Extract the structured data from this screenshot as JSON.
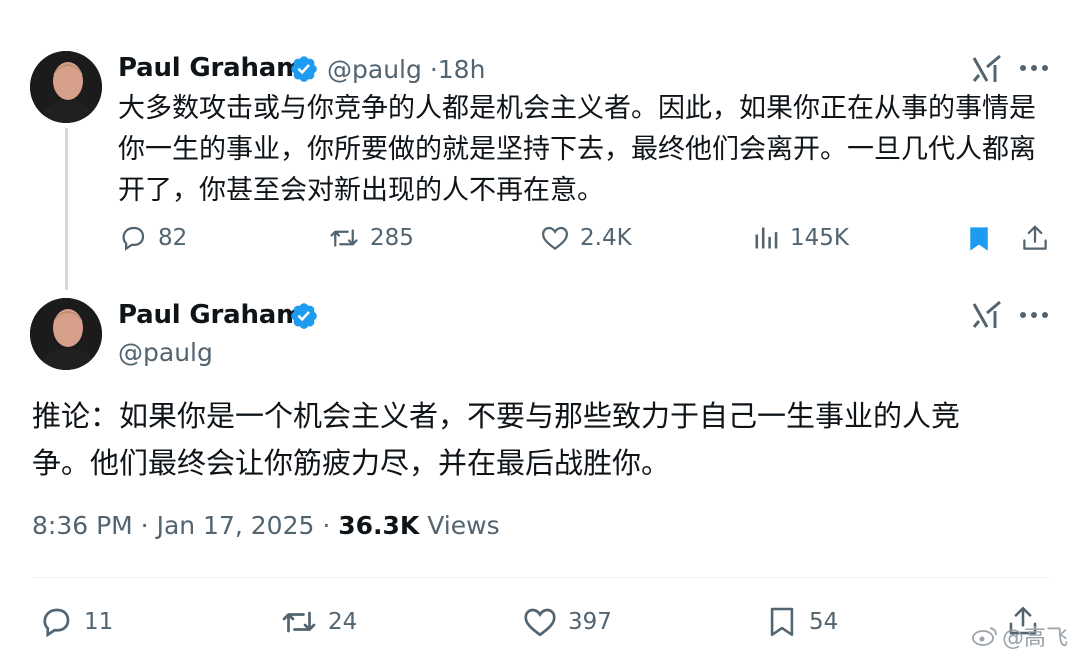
{
  "tweet1": {
    "author_name": "Paul Graham",
    "author_handle": "@paulg",
    "separator": "·",
    "time": "18h",
    "text_lines": [
      "大多数攻击或与你竞争的人都是机会主义者。因此，如果你正在从事的事情是",
      "你一生的事业，你所要做的就是坚持下去，最终他们会离开。一旦几代人都离",
      "开了，你甚至会对新出现的人不再在意。"
    ],
    "replies": "82",
    "reposts": "285",
    "likes": "2.4K",
    "views": "145K",
    "bookmarked": true
  },
  "tweet2": {
    "author_name": "Paul Graham",
    "author_handle": "@paulg",
    "text_lines": [
      "推论：如果你是一个机会主义者，不要与那些致力于自己一生事业的人竞",
      "争。他们最终会让你筋疲力尽，并在最后战胜你。"
    ],
    "timestamp": "8:36 PM · Jan 17, 2025 · ",
    "views_count": "36.3K",
    "views_label": " Views",
    "replies": "11",
    "reposts": "24",
    "likes": "397",
    "bookmarks": "54"
  },
  "icons": {
    "reply": "reply-icon",
    "repost": "repost-icon",
    "like": "heart-icon",
    "views": "views-icon",
    "bookmark": "bookmark-icon",
    "share": "share-icon",
    "grok": "grok-icon",
    "more": "more-icon",
    "verified": "verified-badge-icon"
  },
  "colors": {
    "accent": "#1d9bf0",
    "text": "#0f1419",
    "secondary": "#536471"
  },
  "watermark": "@高飞"
}
